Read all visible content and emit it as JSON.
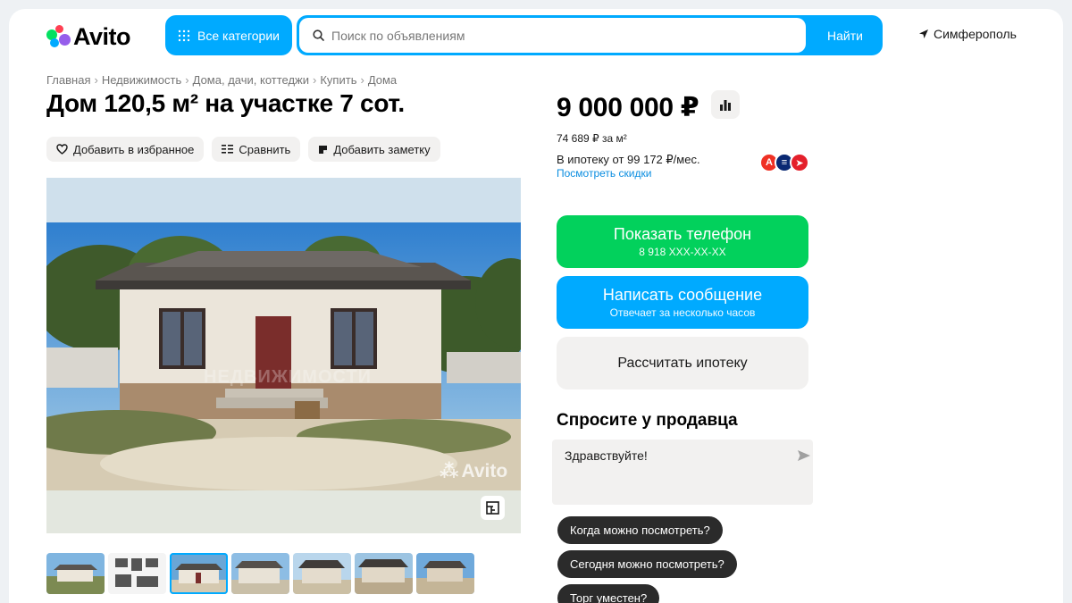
{
  "header": {
    "logo_text": "Avito",
    "categories_label": "Все категории",
    "search_placeholder": "Поиск по объявлениям",
    "search_value": "",
    "search_button": "Найти",
    "location": "Симферополь"
  },
  "breadcrumb": [
    "Главная",
    "Недвижимость",
    "Дома, дачи, коттеджи",
    "Купить",
    "Дома"
  ],
  "listing": {
    "title": "Дом 120,5 м² на участке 7 сот.",
    "actions": {
      "favorite": "Добавить в избранное",
      "compare": "Сравнить",
      "note": "Добавить заметку"
    },
    "photo_watermark": "Avito",
    "photo_overlay_text": "НЕДВИЖИМОСТИ",
    "thumbnail_count": 7,
    "active_thumbnail_index": 2
  },
  "pricing": {
    "price": "9 000 000 ₽",
    "per_meter": "74 689 ₽ за м²",
    "mortgage": "В ипотеку от 99 172 ₽/мес.",
    "discount_link": "Посмотреть скидки"
  },
  "contact": {
    "phone_button": "Показать телефон",
    "phone_masked": "8 918 XXX-XX-XX",
    "message_button": "Написать сообщение",
    "message_sub": "Отвечает за несколько часов",
    "mortgage_button": "Рассчитать ипотеку"
  },
  "ask": {
    "title": "Спросите у продавца",
    "input_value": "Здравствуйте!",
    "questions": [
      "Когда можно посмотреть?",
      "Сегодня можно посмотреть?",
      "Торг уместен?"
    ]
  },
  "colors": {
    "brand_blue": "#00aaff",
    "phone_green": "#02d15c",
    "link_blue": "#0a8de0",
    "chip_dark": "#2b2b2b"
  }
}
